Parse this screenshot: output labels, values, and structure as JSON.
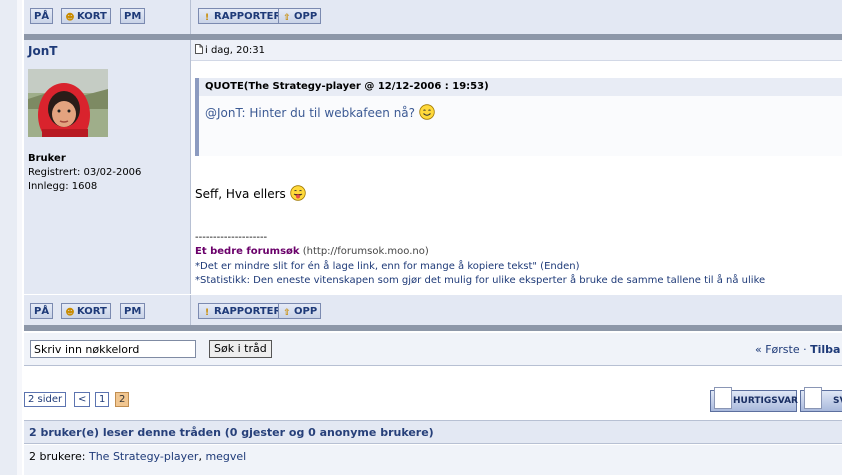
{
  "buttons": {
    "pa": "PÅ",
    "kort": "KORT",
    "pm": "PM",
    "rapporter": "RAPPORTER",
    "opp": "OPP"
  },
  "post": {
    "author": "JonT",
    "date": "i dag, 20:31",
    "group": "Bruker",
    "registered": "Registrert: 03/02-2006",
    "posts": "Innlegg: 1608",
    "quote_header": "QUOTE(The Strategy-player @ 12/12-2006 : 19:53)",
    "quote_text": "@JonT: Hinter du til webkafeen nå?",
    "reply_text": "Seff, Hva ellers",
    "sig_divider": "--------------------",
    "sig_link": "Et bedre forumsøk",
    "sig_url": "(http://forumsok.moo.no)",
    "sig_line2": "*Det er mindre slit for én å lage link, enn for mange å kopiere tekst\" (Enden)",
    "sig_line3": "*Statistikk: Den eneste vitenskapen som gjør det mulig for ulike eksperter å bruke de samme tallene til å nå ulike"
  },
  "search": {
    "input_value": "Skriv inn nøkkelord",
    "button": "Søk i tråd",
    "nav_first": "« Første",
    "nav_back": "Tilba"
  },
  "pagination": {
    "label": "2 sider",
    "prev": "<",
    "p1": "1",
    "p2": "2"
  },
  "actions": {
    "quick_reply": "HURTIGSVAR",
    "reply": "SV"
  },
  "readers": {
    "header": "2 bruker(e) leser denne tråden (0 gjester og 0 anonyme brukere)",
    "prefix": "2 brukere:",
    "user1": "The Strategy-player",
    "sep": ",",
    "user2": "megvel"
  },
  "colors": {
    "accent": "#1e3a78",
    "panel": "#e3e8f3",
    "current_page": "#f1c690"
  }
}
